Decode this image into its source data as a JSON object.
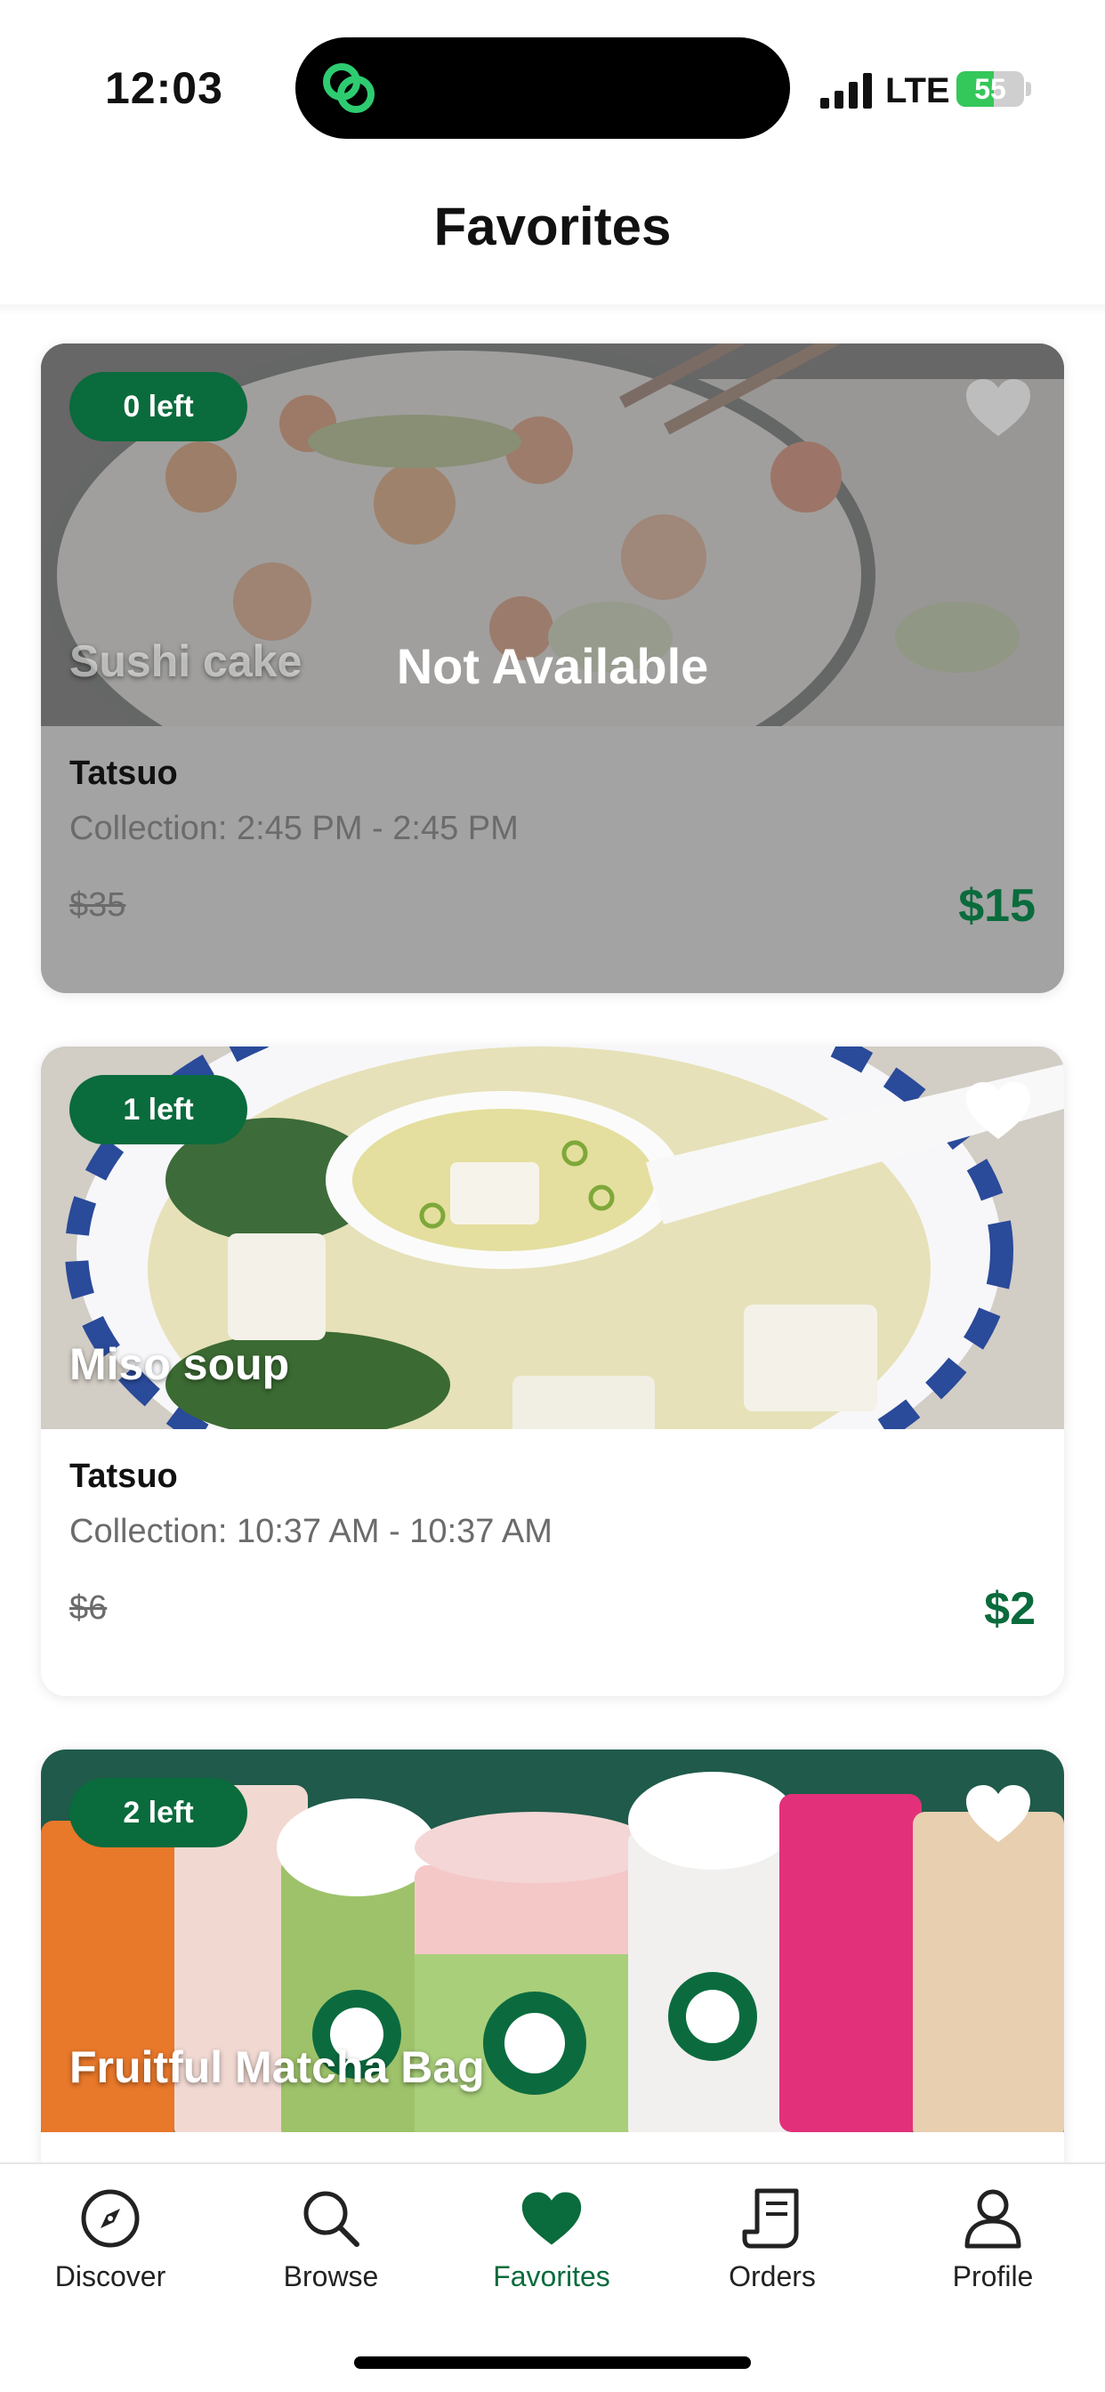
{
  "status": {
    "time": "12:03",
    "network": "LTE",
    "battery": "55",
    "battery_level": 0.55
  },
  "header": {
    "title": "Favorites"
  },
  "cards": [
    {
      "badge": "0 left",
      "title": "Sushi cake",
      "status_label": "Not Available",
      "store": "Tatsuo",
      "collection": "Collection: 2:45 PM - 2:45 PM",
      "old_price": "$35",
      "price": "$15",
      "favorited": true
    },
    {
      "badge": "1 left",
      "title": "Miso soup",
      "store": "Tatsuo",
      "collection": "Collection: 10:37 AM - 10:37 AM",
      "old_price": "$6",
      "price": "$2",
      "favorited": true
    },
    {
      "badge": "2 left",
      "title": "Fruitful Matcha Bag",
      "favorited": true
    }
  ],
  "tabs": [
    {
      "label": "Discover",
      "icon": "compass-icon"
    },
    {
      "label": "Browse",
      "icon": "search-icon"
    },
    {
      "label": "Favorites",
      "icon": "heart-icon",
      "active": true
    },
    {
      "label": "Orders",
      "icon": "receipt-icon"
    },
    {
      "label": "Profile",
      "icon": "person-icon"
    }
  ],
  "colors": {
    "accent": "#0a6b3c",
    "badge": "#0a6b3c",
    "muted_text": "#6b6b6b"
  }
}
